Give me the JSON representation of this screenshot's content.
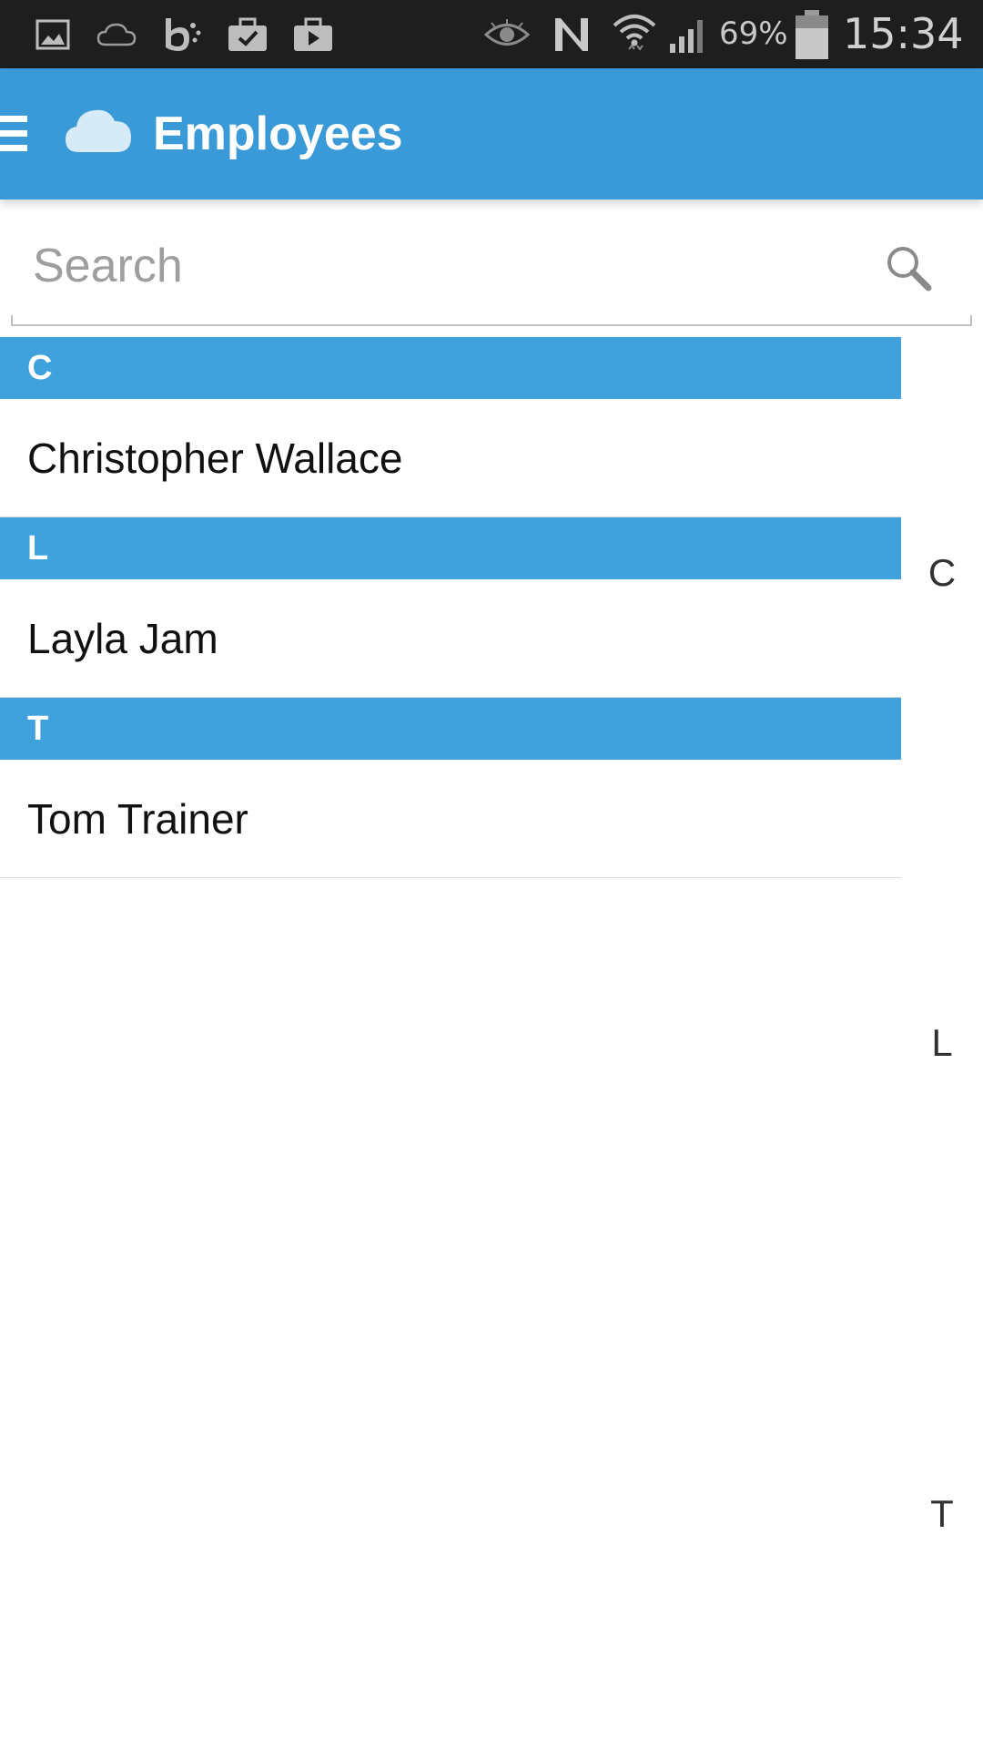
{
  "status_bar": {
    "icons": [
      "gallery-icon",
      "cloud-outline-icon",
      "bing-icon",
      "briefcase-check-icon",
      "briefcase-play-icon",
      "eye-icon",
      "nfc-icon",
      "wifi-icon",
      "cell-signal-icon",
      "battery-icon"
    ],
    "battery_percent": "69%",
    "clock": "15:34",
    "color": "#1e1e1e"
  },
  "app_bar": {
    "title": "Employees",
    "logo": "cloud-icon",
    "menu_icon": "hamburger-menu-icon",
    "color": "#3a9ad7"
  },
  "search": {
    "placeholder": "Search",
    "value": "",
    "icon": "search-icon"
  },
  "list": {
    "header_color": "#3fa2dd",
    "sections": [
      {
        "letter": "C",
        "items": [
          "Christopher Wallace"
        ]
      },
      {
        "letter": "L",
        "items": [
          "Layla Jam"
        ]
      },
      {
        "letter": "T",
        "items": [
          "Tom Trainer"
        ]
      }
    ]
  },
  "side_index": [
    "C",
    "L",
    "T"
  ]
}
